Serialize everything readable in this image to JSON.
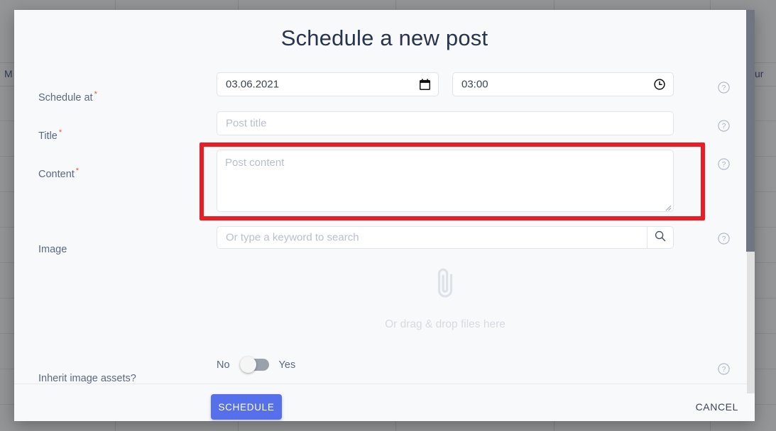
{
  "background": {
    "header_left_text": "M",
    "header_right_text": "ur"
  },
  "modal": {
    "title": "Schedule a new post",
    "fields": {
      "schedule_at": {
        "label": "Schedule at",
        "required_marker": "*",
        "date_value": "03.06.2021",
        "date_icon": "calendar-icon",
        "time_value": "03:00",
        "time_icon": "clock-icon"
      },
      "title": {
        "label": "Title",
        "required_marker": "*",
        "placeholder": "Post title",
        "value": ""
      },
      "content": {
        "label": "Content",
        "required_marker": "*",
        "placeholder": "Post content",
        "value": "",
        "highlight_color": "#ec1c24"
      },
      "image": {
        "label": "Image",
        "required_marker": "",
        "search_placeholder": "Or type a keyword to search",
        "search_value": "",
        "search_icon": "search-icon",
        "dropzone_icon": "paperclip-icon",
        "dropzone_text": "Or drag & drop files here"
      },
      "inherit_image_assets": {
        "label": "Inherit image assets?",
        "off_label": "No",
        "on_label": "Yes",
        "state": "off"
      }
    },
    "help_icon": "help-circle-icon",
    "footer": {
      "primary_label": "SCHEDULE",
      "primary_color": "#5570ea",
      "secondary_label": "CANCEL"
    }
  }
}
